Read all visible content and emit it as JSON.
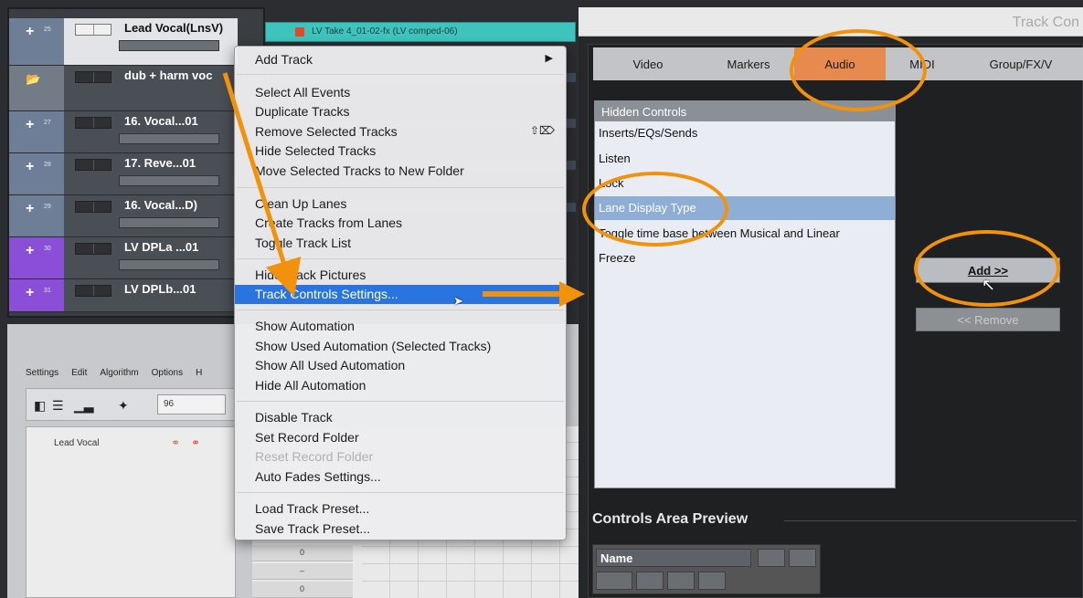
{
  "tracks": [
    {
      "num": "25",
      "name": "Lead Vocal(LnsV)"
    },
    {
      "num": "",
      "name": "dub + harm voc"
    },
    {
      "num": "27",
      "name": "16. Vocal...01"
    },
    {
      "num": "28",
      "name": "17. Reve...01"
    },
    {
      "num": "29",
      "name": "16. Vocal...D)"
    },
    {
      "num": "30",
      "name": "LV DPLa ...01"
    },
    {
      "num": "31",
      "name": "LV DPLb...01"
    }
  ],
  "lane_event": "LV Take 4_01-02-fx (LV comped-06)",
  "editor": {
    "menu": [
      "Settings",
      "Edit",
      "Algorithm",
      "Options",
      "H"
    ],
    "field_value": "96",
    "track_label": "Lead Vocal",
    "grid_rows": [
      "0",
      "–",
      "0"
    ]
  },
  "context_menu": {
    "add_track": "Add Track",
    "select_all_events": "Select All Events",
    "duplicate_tracks": "Duplicate Tracks",
    "remove_selected_tracks": "Remove Selected Tracks",
    "remove_shortcut": "⇧⌦",
    "hide_selected_tracks": "Hide Selected Tracks",
    "move_to_folder": "Move Selected Tracks to New Folder",
    "clean_up_lanes": "Clean Up Lanes",
    "create_tracks_from_lanes": "Create Tracks from Lanes",
    "toggle_track_list": "Toggle Track List",
    "hide_track_pictures": "Hide Track Pictures",
    "track_controls_settings": "Track Controls Settings...",
    "show_automation": "Show Automation",
    "show_used_automation": "Show Used Automation (Selected Tracks)",
    "show_all_used_automation": "Show All Used Automation",
    "hide_all_automation": "Hide All Automation",
    "disable_track": "Disable Track",
    "set_record_folder": "Set Record Folder",
    "reset_record_folder": "Reset Record Folder",
    "auto_fades_settings": "Auto Fades Settings...",
    "load_track_preset": "Load Track Preset...",
    "save_track_preset": "Save Track Preset..."
  },
  "dialog": {
    "title": "Track Con",
    "tabs": [
      "Video",
      "Markers",
      "Audio",
      "MIDI",
      "Group/FX/V"
    ],
    "active_tab": "Audio",
    "hidden_controls_header": "Hidden Controls",
    "hidden_controls": [
      "Inserts/EQs/Sends",
      "Listen",
      "Lock",
      "Lane Display Type",
      "Toggle time base between Musical and Linear",
      "Freeze"
    ],
    "selected_control": "Lane Display Type",
    "add_button": "Add >>",
    "remove_button": "<< Remove",
    "preview_title": "Controls Area Preview",
    "preview_name": "Name"
  },
  "colors": {
    "highlight": "#2a74e0",
    "annotation_orange": "#f2920c",
    "active_tab": "#e68a4f",
    "selection": "#8eaed6"
  }
}
